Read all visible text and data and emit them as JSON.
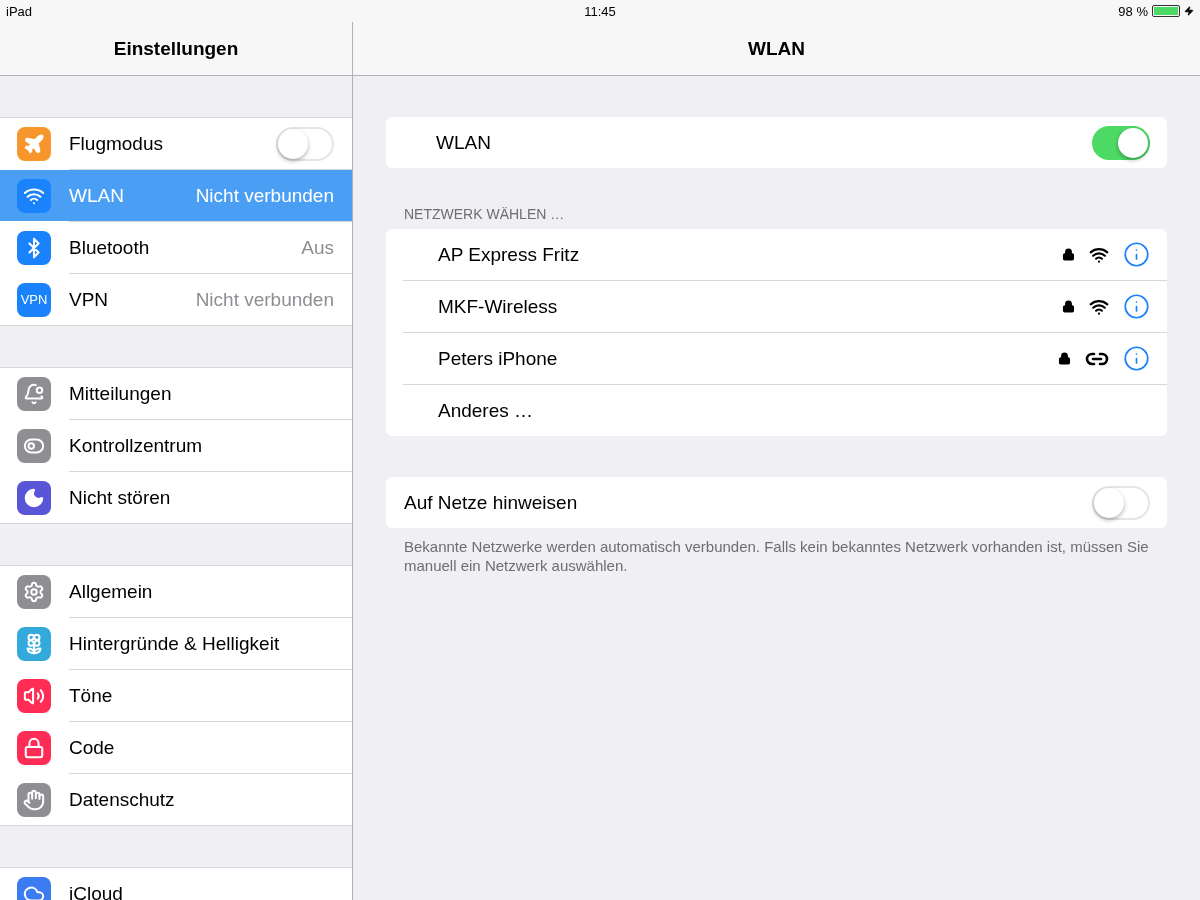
{
  "status_bar": {
    "device": "iPad",
    "time": "11:45",
    "battery": "98 %",
    "charging": true
  },
  "sidebar": {
    "title": "Einstellungen",
    "groups": [
      [
        {
          "label": "Flugmodus",
          "color": "#f7962d",
          "kind": "toggle",
          "on": false,
          "selected": false
        },
        {
          "label": "WLAN",
          "value": "Nicht verbunden",
          "color": "#1a82fb",
          "kind": "detail",
          "selected": true
        },
        {
          "label": "Bluetooth",
          "value": "Aus",
          "color": "#1a82fb",
          "kind": "detail",
          "selected": false
        },
        {
          "label": "VPN",
          "value": "Nicht verbunden",
          "icon_text": "VPN",
          "color": "#1a82fb",
          "kind": "detail",
          "selected": false
        }
      ],
      [
        {
          "label": "Mitteilungen",
          "color": "#8e8e93",
          "kind": "plain",
          "selected": false
        },
        {
          "label": "Kontrollzentrum",
          "color": "#8e8e93",
          "kind": "plain",
          "selected": false
        },
        {
          "label": "Nicht stören",
          "color": "#5856d6",
          "kind": "plain",
          "selected": false
        }
      ],
      [
        {
          "label": "Allgemein",
          "color": "#8e8e93",
          "kind": "plain",
          "selected": false
        },
        {
          "label": "Hintergründe & Helligkeit",
          "color": "#34aadc",
          "kind": "plain",
          "selected": false
        },
        {
          "label": "Töne",
          "color": "#ff2d55",
          "kind": "plain",
          "selected": false
        },
        {
          "label": "Code",
          "color": "#ff2d55",
          "kind": "plain",
          "selected": false
        },
        {
          "label": "Datenschutz",
          "color": "#8e8e93",
          "kind": "plain",
          "selected": false
        }
      ],
      [
        {
          "label": "iCloud",
          "color": "#3b7cf0",
          "kind": "plain",
          "selected": false
        }
      ]
    ]
  },
  "main": {
    "title": "WLAN",
    "wlan": {
      "label": "WLAN",
      "on": true
    },
    "section_header": "NETZWERK WÄHLEN …",
    "networks": [
      {
        "name": "AP Express Fritz",
        "kind": "wifi",
        "locked": true
      },
      {
        "name": "MKF-Wireless",
        "kind": "wifi",
        "locked": true
      },
      {
        "name": "Peters iPhone",
        "kind": "hotspot",
        "locked": true
      },
      {
        "name": "Anderes …",
        "kind": "other"
      }
    ],
    "ask": {
      "label": "Auf Netze hinweisen",
      "on": false
    },
    "footer": "Bekannte Netzwerke werden automatisch verbunden. Falls kein bekanntes Netzwerk vorhanden ist, müssen Sie manuell ein Netzwerk auswählen."
  }
}
